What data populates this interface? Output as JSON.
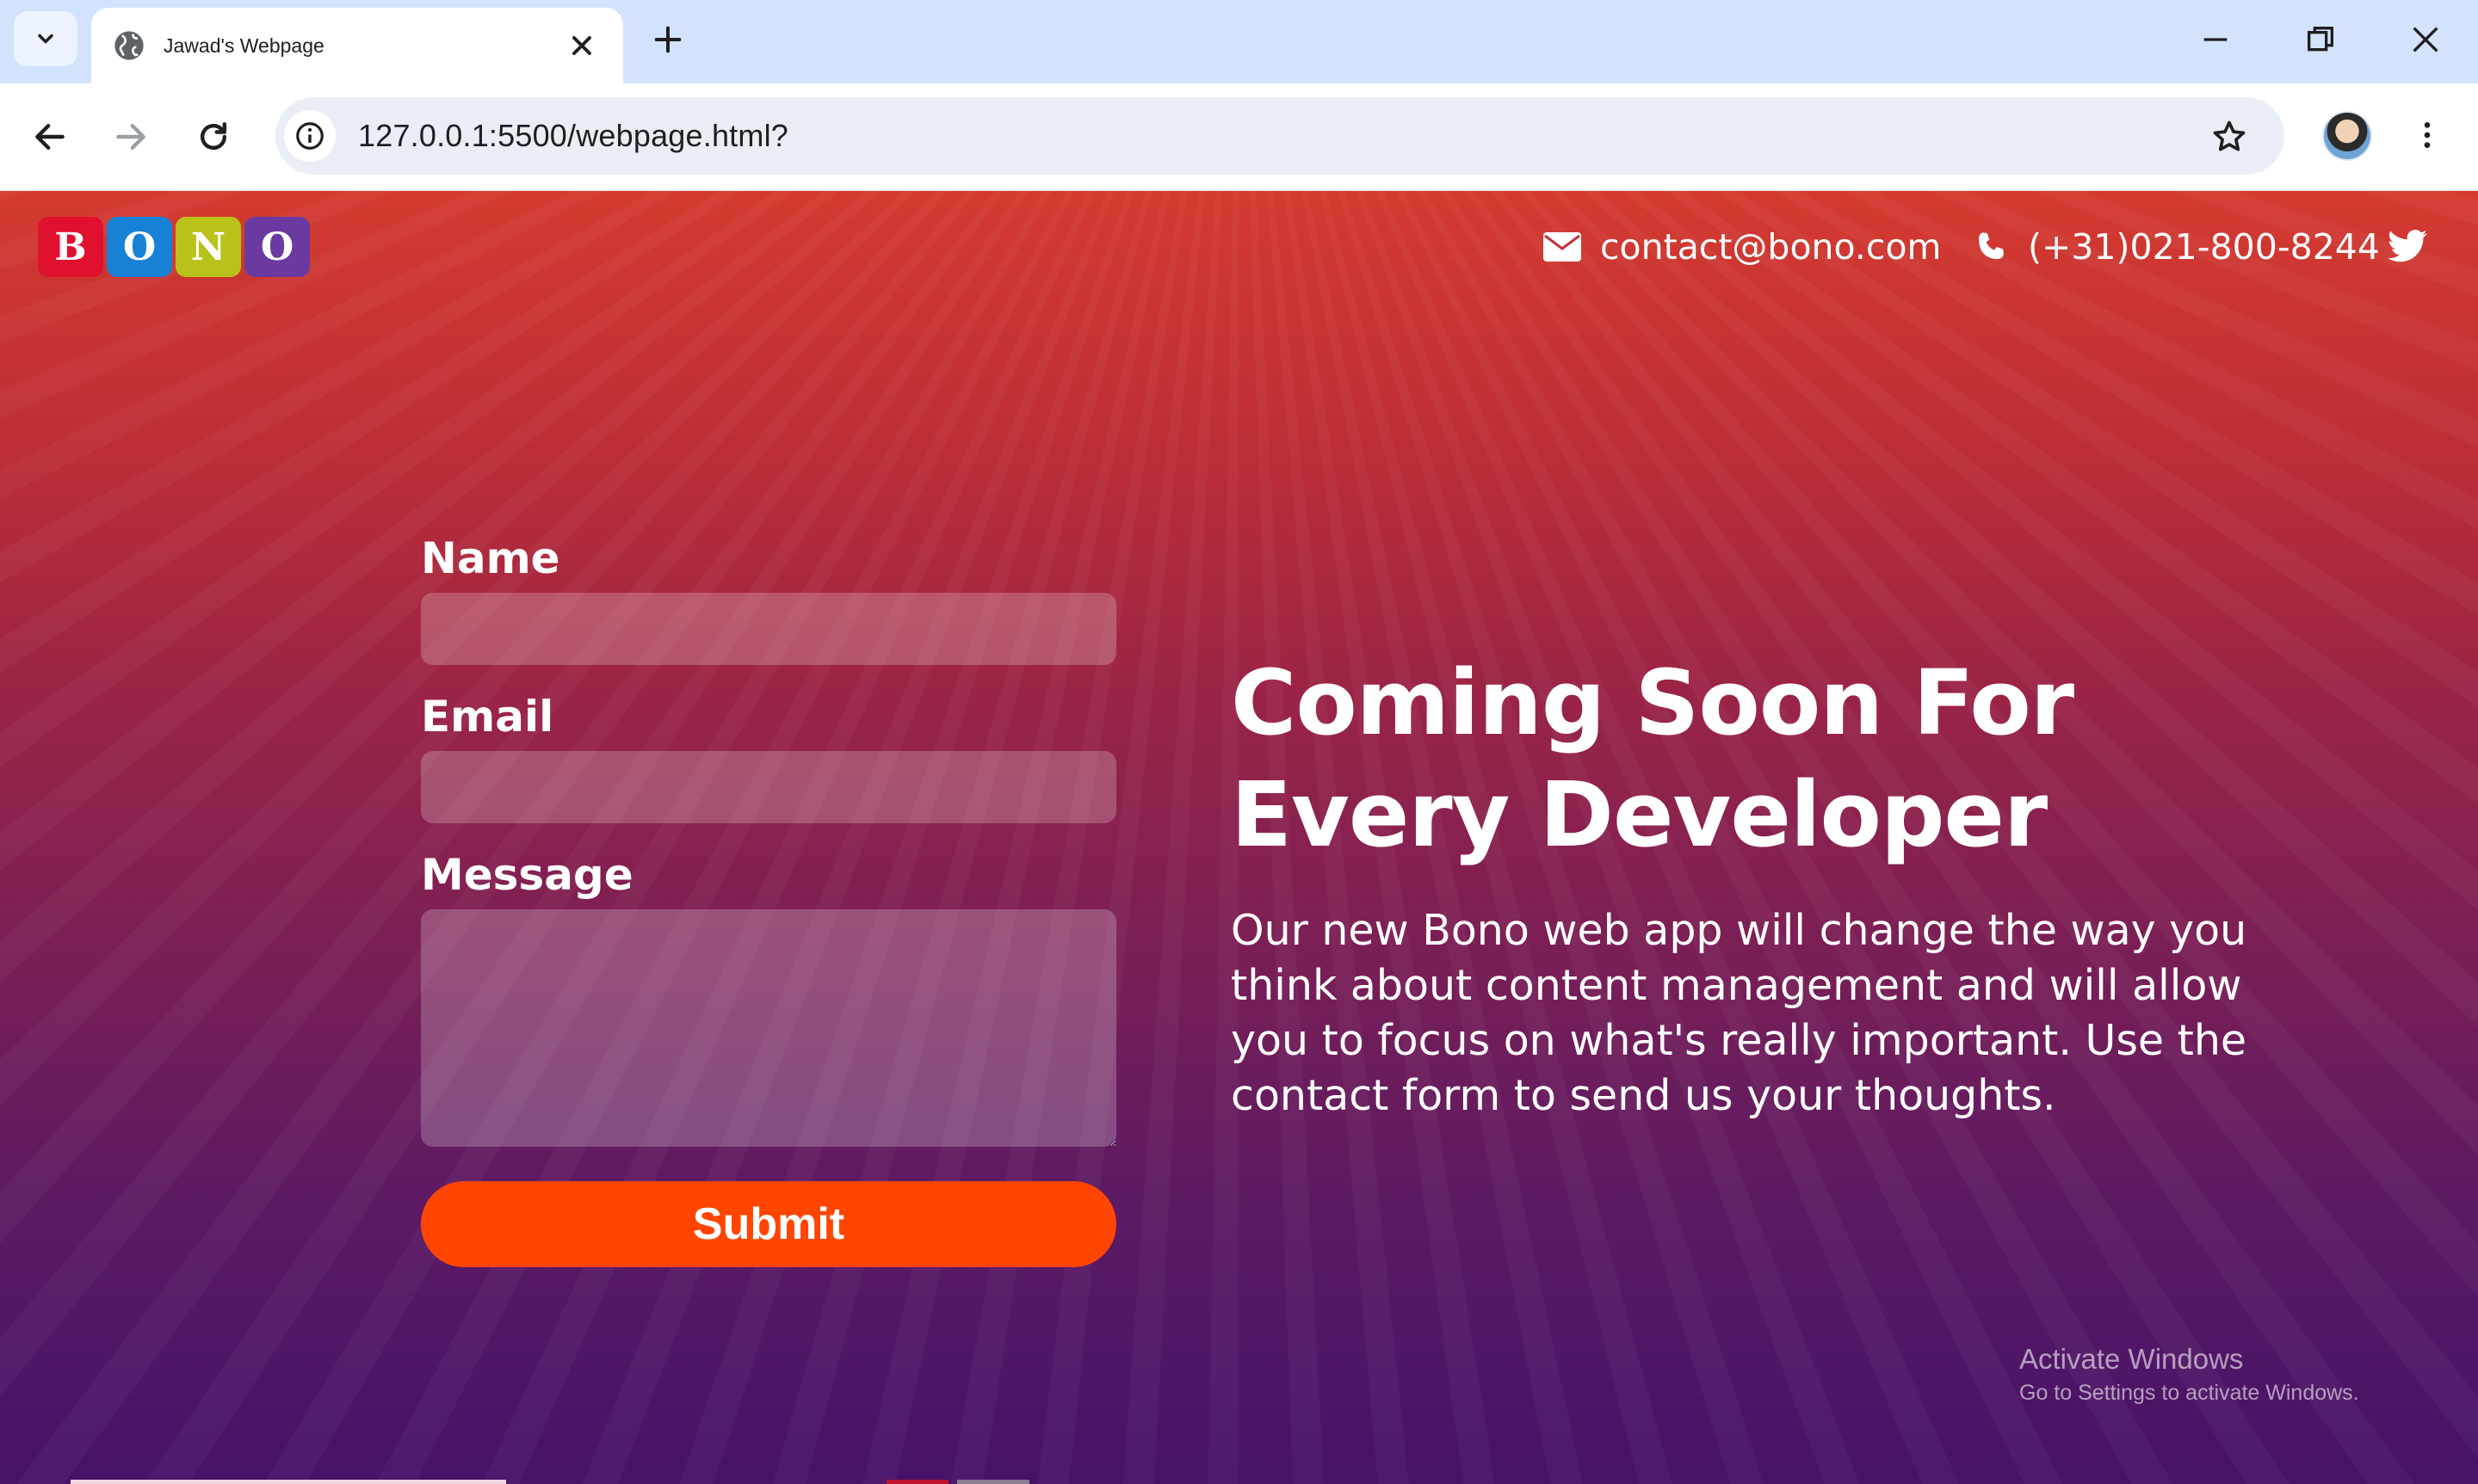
{
  "browser": {
    "tab_title": "Jawad's Webpage",
    "url": "127.0.0.1:5500/webpage.html?"
  },
  "page": {
    "logo_letters": [
      "B",
      "O",
      "N",
      "O"
    ],
    "logo_colors": [
      "#e0112f",
      "#1781d6",
      "#b8c21a",
      "#6a3aa0"
    ],
    "email": "contact@bono.com",
    "phone": "(+31)021-800-8244",
    "form": {
      "name_label": "Name",
      "email_label": "Email",
      "message_label": "Message",
      "name_value": "",
      "email_value": "",
      "message_value": "",
      "submit_label": "Submit"
    },
    "hero": {
      "title_line1": "Coming Soon For",
      "title_line2": "Every Developer",
      "description": "Our new Bono web app will change the way you think about content management and will allow you to focus on what's really important. Use the contact form to send us your thoughts."
    }
  },
  "watermark": {
    "title": "Activate Windows",
    "subtitle": "Go to Settings to activate Windows."
  },
  "colors": {
    "submit": "#ff4500",
    "tabbar": "#d3e3fd"
  }
}
